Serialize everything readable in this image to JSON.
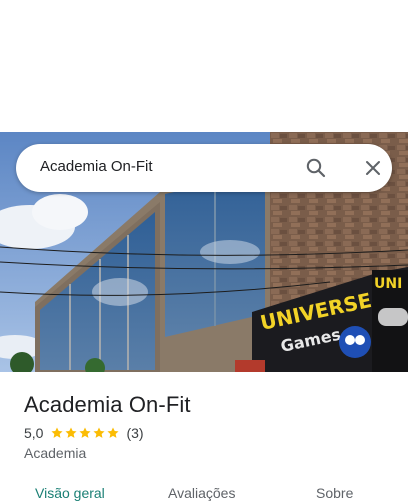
{
  "search": {
    "query": "Academia On-Fit"
  },
  "place": {
    "name": "Academia On-Fit",
    "rating": "5,0",
    "stars": 5,
    "review_count": "(3)",
    "category": "Academia"
  },
  "photo": {
    "sign_brand": "UNIVERSE",
    "sign_sub": "Games",
    "sign_right": "UNI"
  },
  "tabs": [
    {
      "label": "Visão geral",
      "active": true
    },
    {
      "label": "Avaliações",
      "active": false
    },
    {
      "label": "Sobre",
      "active": false
    }
  ],
  "colors": {
    "active_tab": "#1a7f74",
    "star": "#fbbc04",
    "text": "#202124"
  },
  "icons": {
    "search": "search-icon",
    "close": "close-icon",
    "star": "star-icon"
  }
}
